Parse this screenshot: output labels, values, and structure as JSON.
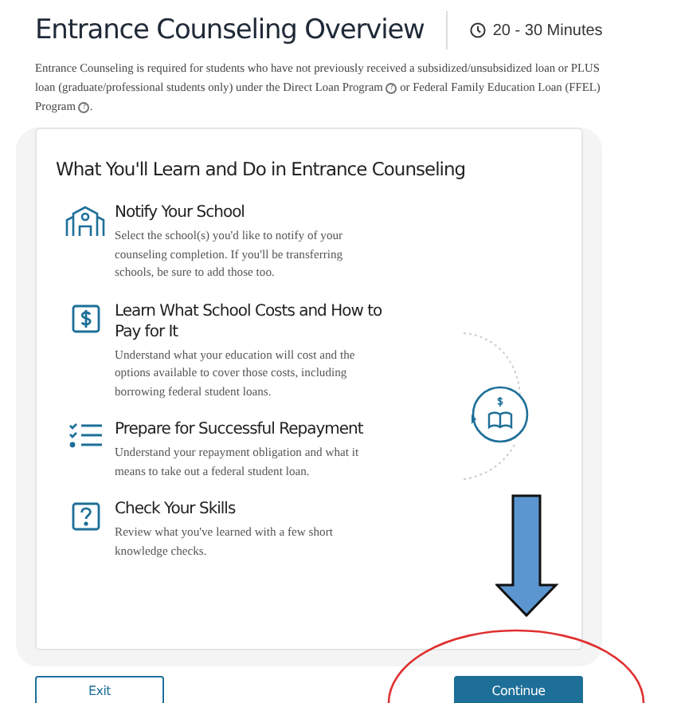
{
  "header": {
    "title": "Entrance Counseling Overview",
    "duration": "20 - 30 Minutes"
  },
  "intro": [
    {
      "kind": "text",
      "text": "Entrance Counseling is required for students who have not previously received a subsidized/unsubsidized loan or PLUS loan (graduate/professional students only) under the Direct Loan Program "
    },
    {
      "kind": "help",
      "text": "?"
    },
    {
      "kind": "text",
      "text": " or Federal Family Education Loan (FFEL) Program "
    },
    {
      "kind": "help",
      "text": "?"
    },
    {
      "kind": "text",
      "text": "."
    }
  ],
  "card": {
    "title": "What You'll Learn and Do in Entrance Counseling",
    "items": [
      {
        "kind": "school",
        "title": "Notify Your School",
        "text": "Select the school(s) you'd like to notify of your counseling completion. If you'll be transferring schools, be sure to add those too."
      },
      {
        "kind": "dollar",
        "title": "Learn What School Costs and How to Pay for It",
        "text": "Understand what your education will cost and the options available to cover those costs, including borrowing federal student loans."
      },
      {
        "kind": "checklist",
        "title": "Prepare for Successful Repayment",
        "text": "Understand your repayment obligation and what it means to take out a federal student loan."
      },
      {
        "kind": "question",
        "title": "Check Your Skills",
        "text": "Review what you've learned with a few short knowledge checks."
      }
    ]
  },
  "buttons": [
    {
      "kind": "secondary",
      "label": "Exit"
    },
    {
      "kind": "primary",
      "label": "Continue"
    }
  ]
}
